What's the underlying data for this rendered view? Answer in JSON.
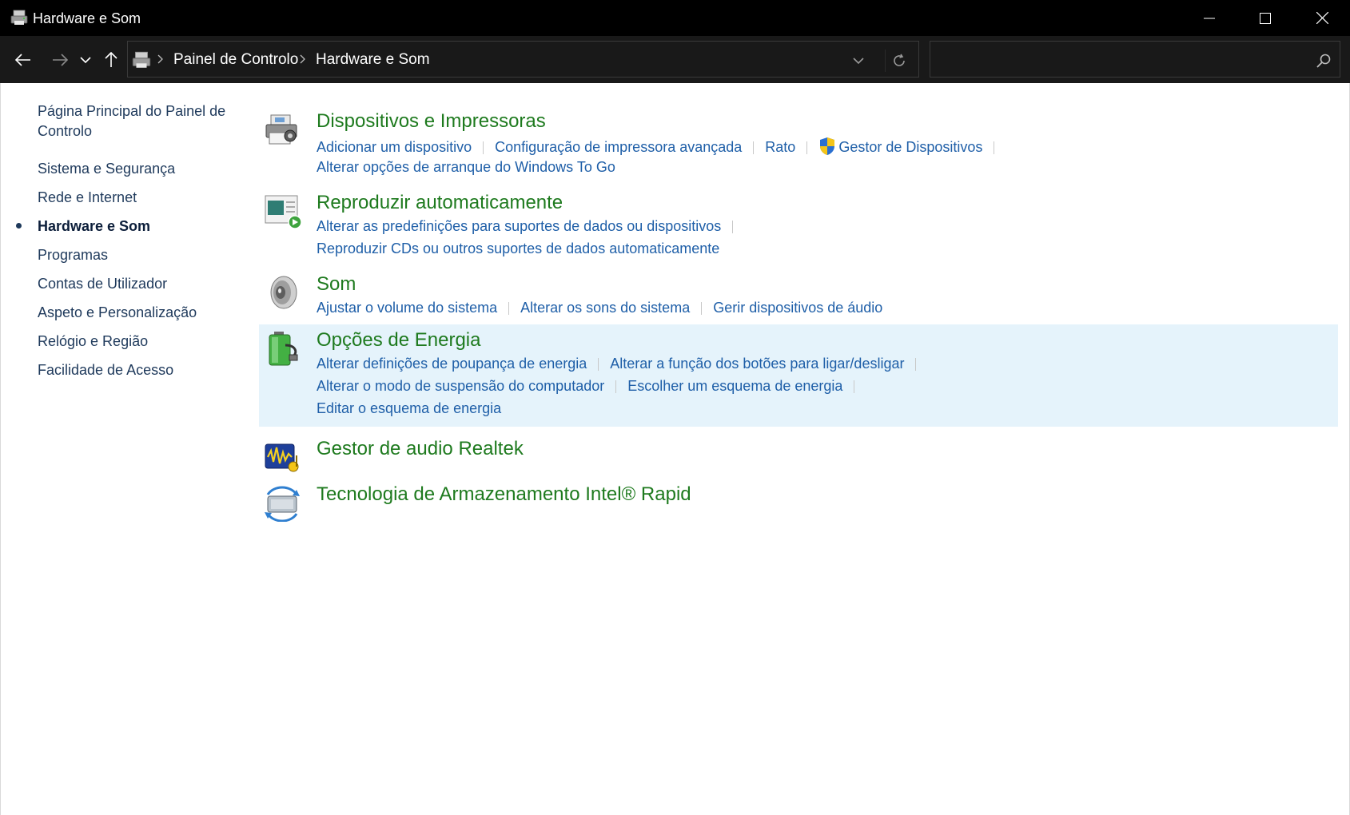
{
  "window": {
    "title": "Hardware e Som"
  },
  "address": {
    "breadcrumbs": [
      "Painel de Controlo",
      "Hardware e Som"
    ],
    "search_placeholder": ""
  },
  "sidebar": {
    "items": [
      {
        "label": "Página Principal do Painel de"
      },
      {
        "label": "Controlo"
      },
      {
        "label": "Sistema e Segurança"
      },
      {
        "label": "Rede e Internet"
      },
      {
        "label": "Hardware e Som",
        "current": true
      },
      {
        "label": "Programas"
      },
      {
        "label": "Contas de Utilizador"
      },
      {
        "label": "Aspeto e Personalização"
      },
      {
        "label": "Relógio e Região"
      },
      {
        "label": "Facilidade de Acesso"
      }
    ]
  },
  "categories": [
    {
      "title": "Dispositivos e Impressoras",
      "icon": "printer-icon",
      "links": [
        "Adicionar um dispositivo",
        "Configuração de impressora avançada",
        "Rato",
        "Gestor de Dispositivos",
        "Alterar opções de arranque do Windows To Go"
      ]
    },
    {
      "title": "Reproduzir automaticamente",
      "icon": "autoplay-icon",
      "links": [
        "Alterar as predefinições para suportes de dados ou dispositivos",
        "Reproduzir CDs ou outros suportes de dados automaticamente"
      ]
    },
    {
      "title": "Som",
      "icon": "speaker-icon",
      "links": [
        "Ajustar o volume do sistema",
        "Alterar os sons do sistema",
        "Gerir dispositivos de áudio"
      ]
    },
    {
      "title": "Opções de Energia",
      "icon": "battery-icon",
      "links": [
        "Alterar definições de poupança de energia",
        "Alterar a função dos botões para ligar/desligar",
        "Alterar o modo de suspensão do computador",
        "Escolher um esquema de energia",
        "Editar o esquema de energia"
      ]
    },
    {
      "title": "Gestor de audio Realtek",
      "icon": "realtek-audio-icon",
      "links": []
    },
    {
      "title": "Tecnologia de Armazenamento Intel® Rapid",
      "icon": "intel-rapid-storage-icon",
      "links": []
    }
  ],
  "colors": {
    "titlebar": "#000000",
    "addressbar": "#191919",
    "category_title": "#1e7a1e",
    "link": "#1f5fa8",
    "sidebar_text": "#1e395b",
    "highlight": "#e5f3fb"
  }
}
